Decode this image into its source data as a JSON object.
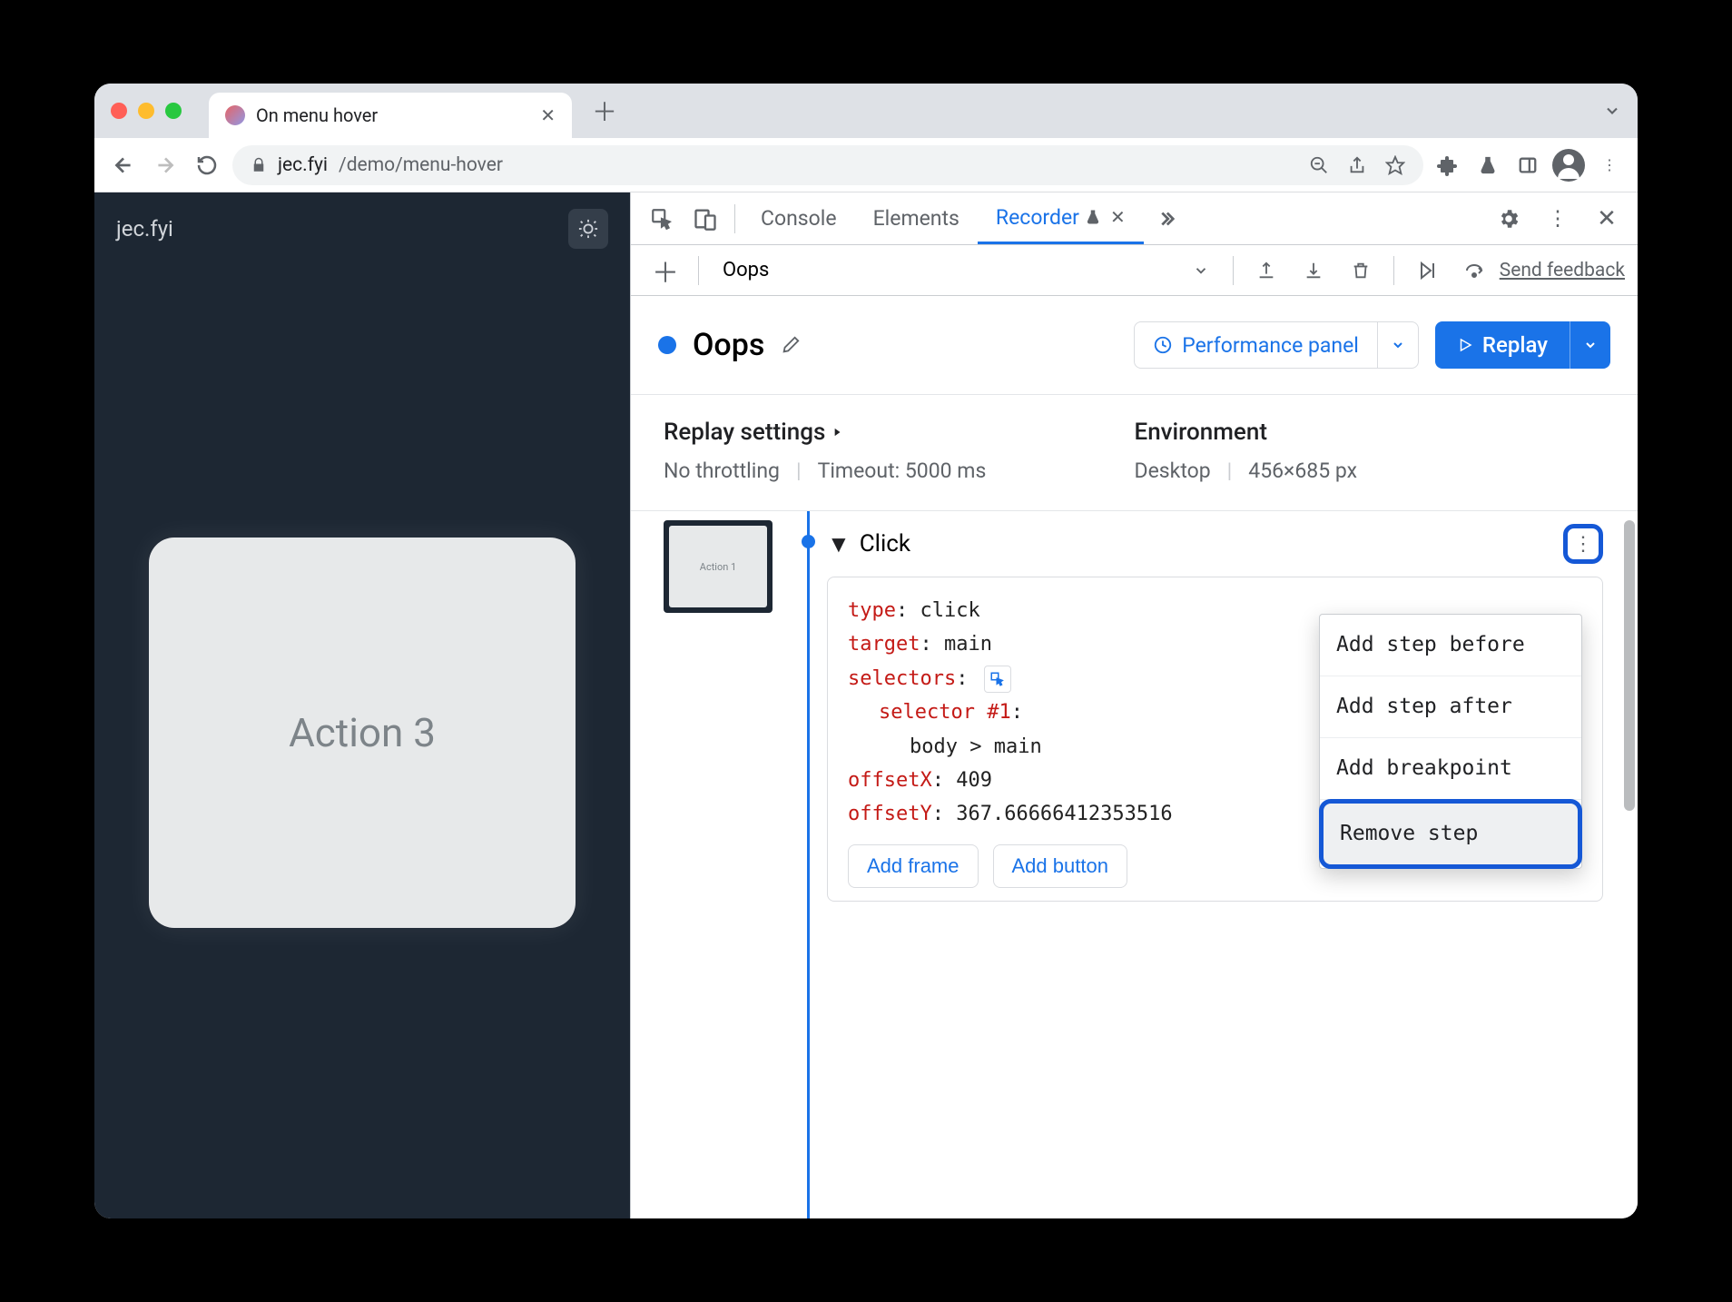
{
  "browser": {
    "tab_title": "On menu hover",
    "url_host": "jec.fyi",
    "url_path": "/demo/menu-hover"
  },
  "page": {
    "site_name": "jec.fyi",
    "card_label": "Action 3"
  },
  "devtools": {
    "tabs": {
      "console": "Console",
      "elements": "Elements",
      "recorder": "Recorder"
    }
  },
  "recorder": {
    "recording_name": "Oops",
    "feedback": "Send feedback",
    "title": "Oops",
    "perf_panel": "Performance panel",
    "replay": "Replay",
    "replay_settings_label": "Replay settings",
    "environment_label": "Environment",
    "throttling": "No throttling",
    "timeout": "Timeout: 5000 ms",
    "env_device": "Desktop",
    "env_size": "456×685 px",
    "thumb_label": "Action 1"
  },
  "step": {
    "name": "Click",
    "props": {
      "type_key": "type",
      "type_val": "click",
      "target_key": "target",
      "target_val": "main",
      "selectors_key": "selectors",
      "selector_n_key": "selector #1",
      "selector_val": "body > main",
      "offsetx_key": "offsetX",
      "offsetx_val": "409",
      "offsety_key": "offsetY",
      "offsety_val": "367.66666412353516"
    },
    "add_frame": "Add frame",
    "add_button": "Add button"
  },
  "context_menu": {
    "before": "Add step before",
    "after": "Add step after",
    "breakpoint": "Add breakpoint",
    "remove": "Remove step"
  }
}
